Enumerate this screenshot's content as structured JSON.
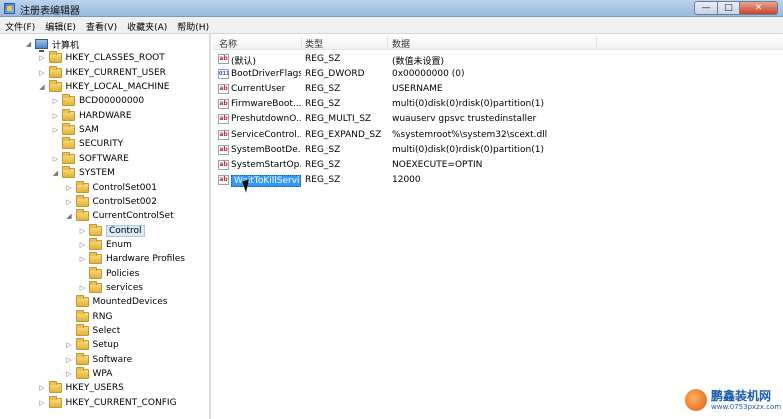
{
  "window": {
    "title": "注册表编辑器",
    "buttons": {
      "minimize": "—",
      "maximize": "□",
      "close": "✕"
    }
  },
  "menu": [
    "文件(F)",
    "编辑(E)",
    "查看(V)",
    "收藏夹(A)",
    "帮助(H)"
  ],
  "tree": [
    {
      "label": "计算机",
      "depth": 0,
      "toggle": "open",
      "icon": "computer-icon"
    },
    {
      "label": "HKEY_CLASSES_ROOT",
      "depth": 1,
      "toggle": "closed",
      "icon": "folder-icon"
    },
    {
      "label": "HKEY_CURRENT_USER",
      "depth": 1,
      "toggle": "closed",
      "icon": "folder-icon"
    },
    {
      "label": "HKEY_LOCAL_MACHINE",
      "depth": 1,
      "toggle": "open",
      "icon": "folder-icon"
    },
    {
      "label": "BCD00000000",
      "depth": 2,
      "toggle": "closed",
      "icon": "folder-icon"
    },
    {
      "label": "HARDWARE",
      "depth": 2,
      "toggle": "closed",
      "icon": "folder-icon"
    },
    {
      "label": "SAM",
      "depth": 2,
      "toggle": "closed",
      "icon": "folder-icon"
    },
    {
      "label": "SECURITY",
      "depth": 2,
      "toggle": "none",
      "icon": "folder-icon"
    },
    {
      "label": "SOFTWARE",
      "depth": 2,
      "toggle": "closed",
      "icon": "folder-icon"
    },
    {
      "label": "SYSTEM",
      "depth": 2,
      "toggle": "open",
      "icon": "folder-icon"
    },
    {
      "label": "ControlSet001",
      "depth": 3,
      "toggle": "closed",
      "icon": "folder-icon"
    },
    {
      "label": "ControlSet002",
      "depth": 3,
      "toggle": "closed",
      "icon": "folder-icon"
    },
    {
      "label": "CurrentControlSet",
      "depth": 3,
      "toggle": "open",
      "icon": "folder-icon"
    },
    {
      "label": "Control",
      "depth": 4,
      "toggle": "closed",
      "icon": "folder-icon",
      "selected": true
    },
    {
      "label": "Enum",
      "depth": 4,
      "toggle": "closed",
      "icon": "folder-icon"
    },
    {
      "label": "Hardware Profiles",
      "depth": 4,
      "toggle": "closed",
      "icon": "folder-icon"
    },
    {
      "label": "Policies",
      "depth": 4,
      "toggle": "none",
      "icon": "folder-icon"
    },
    {
      "label": "services",
      "depth": 4,
      "toggle": "closed",
      "icon": "folder-icon"
    },
    {
      "label": "MountedDevices",
      "depth": 3,
      "toggle": "none",
      "icon": "folder-icon"
    },
    {
      "label": "RNG",
      "depth": 3,
      "toggle": "none",
      "icon": "folder-icon"
    },
    {
      "label": "Select",
      "depth": 3,
      "toggle": "none",
      "icon": "folder-icon"
    },
    {
      "label": "Setup",
      "depth": 3,
      "toggle": "closed",
      "icon": "folder-icon"
    },
    {
      "label": "Software",
      "depth": 3,
      "toggle": "closed",
      "icon": "folder-icon"
    },
    {
      "label": "WPA",
      "depth": 3,
      "toggle": "closed",
      "icon": "folder-icon"
    },
    {
      "label": "HKEY_USERS",
      "depth": 1,
      "toggle": "closed",
      "icon": "folder-icon"
    },
    {
      "label": "HKEY_CURRENT_CONFIG",
      "depth": 1,
      "toggle": "closed",
      "icon": "folder-icon"
    }
  ],
  "list": {
    "columns": {
      "name": "名称",
      "type": "类型",
      "data": "数据"
    },
    "rows": [
      {
        "icon": "string-value-icon",
        "name": "(默认)",
        "type": "REG_SZ",
        "data": "(数值未设置)"
      },
      {
        "icon": "binary-value-icon",
        "name": "BootDriverFlags",
        "type": "REG_DWORD",
        "data": "0x00000000 (0)"
      },
      {
        "icon": "string-value-icon",
        "name": "CurrentUser",
        "type": "REG_SZ",
        "data": "USERNAME"
      },
      {
        "icon": "string-value-icon",
        "name": "FirmwareBoot...",
        "type": "REG_SZ",
        "data": "multi(0)disk(0)rdisk(0)partition(1)"
      },
      {
        "icon": "string-value-icon",
        "name": "PreshutdownO...",
        "type": "REG_MULTI_SZ",
        "data": "wuauserv gpsvc trustedinstaller"
      },
      {
        "icon": "string-value-icon",
        "name": "ServiceControl...",
        "type": "REG_EXPAND_SZ",
        "data": "%systemroot%\\system32\\scext.dll"
      },
      {
        "icon": "string-value-icon",
        "name": "SystemBootDe...",
        "type": "REG_SZ",
        "data": "multi(0)disk(0)rdisk(0)partition(1)"
      },
      {
        "icon": "string-value-icon",
        "name": "SystemStartOp...",
        "type": "REG_SZ",
        "data": " NOEXECUTE=OPTIN"
      },
      {
        "icon": "string-value-icon",
        "name": "WaitToKillServi...",
        "type": "REG_SZ",
        "data": "12000",
        "selected": true
      }
    ]
  },
  "watermark": {
    "title": "鹏鑫装机网",
    "url": "www.0753pxzx.com"
  },
  "icon_text": {
    "string": "ab",
    "binary": "011"
  }
}
